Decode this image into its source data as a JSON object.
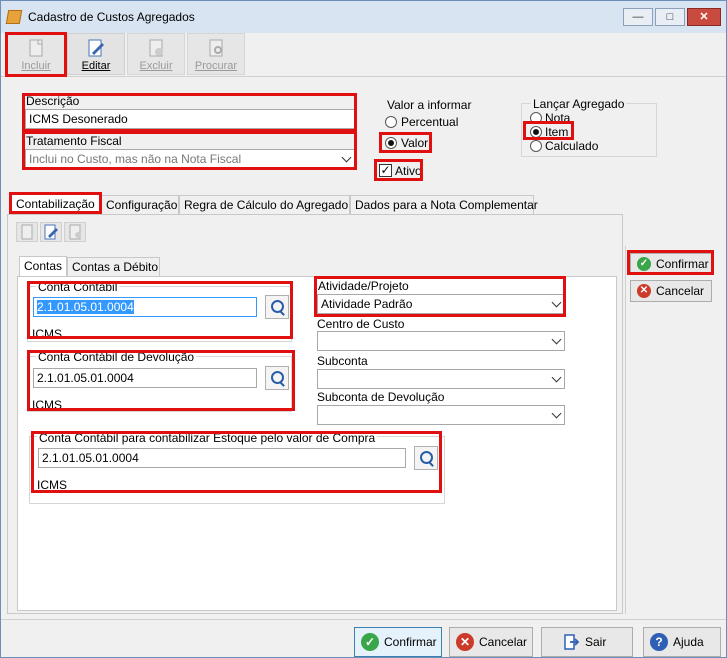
{
  "window": {
    "title": "Cadastro de Custos Agregados"
  },
  "toolbar": {
    "incluir": "Incluir",
    "editar": "Editar",
    "excluir": "Excluir",
    "procurar": "Procurar"
  },
  "form": {
    "descricao_label": "Descrição",
    "descricao_value": "ICMS Desonerado",
    "tratamento_label": "Tratamento Fiscal",
    "tratamento_value": "Inclui no Custo, mas não na Nota Fiscal",
    "valor_informar_label": "Valor a informar",
    "percentual_label": "Percentual",
    "valor_label": "Valor",
    "valor_selected": "Valor",
    "lancar_label": "Lançar Agregado",
    "nota_label": "Nota",
    "item_label": "Item",
    "calculado_label": "Calculado",
    "lancar_selected": "Item",
    "ativo_label": "Ativo",
    "ativo_checked": true
  },
  "tabs": [
    {
      "label": "Contabilização",
      "active": true
    },
    {
      "label": "Configuração",
      "active": false
    },
    {
      "label": "Regra de Cálculo do Agregado",
      "active": false
    },
    {
      "label": "Dados para a Nota Complementar",
      "active": false
    }
  ],
  "subtabs": [
    {
      "label": "Contas",
      "active": true
    },
    {
      "label": "Contas a Débito",
      "active": false
    }
  ],
  "contas": {
    "conta_contabil_label": "Conta Contábil",
    "conta_contabil_value": "2.1.01.05.01.0004",
    "conta_contabil_desc": "ICMS",
    "conta_devolucao_label": "Conta Contábil de Devolução",
    "conta_devolucao_value": "2.1.01.05.01.0004",
    "conta_devolucao_desc": "ICMS",
    "conta_estoque_label": "Conta Contábil para contabilizar Estoque pelo valor de Compra",
    "conta_estoque_value": "2.1.01.05.01.0004",
    "conta_estoque_desc": "ICMS",
    "atividade_label": "Atividade/Projeto",
    "atividade_value": "Atividade Padrão",
    "centro_label": "Centro de Custo",
    "centro_value": "",
    "subconta_label": "Subconta",
    "subconta_value": "",
    "subconta_dev_label": "Subconta de Devolução",
    "subconta_dev_value": ""
  },
  "side_buttons": {
    "confirmar": "Confirmar",
    "cancelar": "Cancelar"
  },
  "footer": {
    "confirmar": "Confirmar",
    "cancelar": "Cancelar",
    "sair": "Sair",
    "ajuda": "Ajuda"
  },
  "colors": {
    "highlight": "#e01010",
    "selection": "#3399ff",
    "titlebar": "#d8e4f2"
  }
}
